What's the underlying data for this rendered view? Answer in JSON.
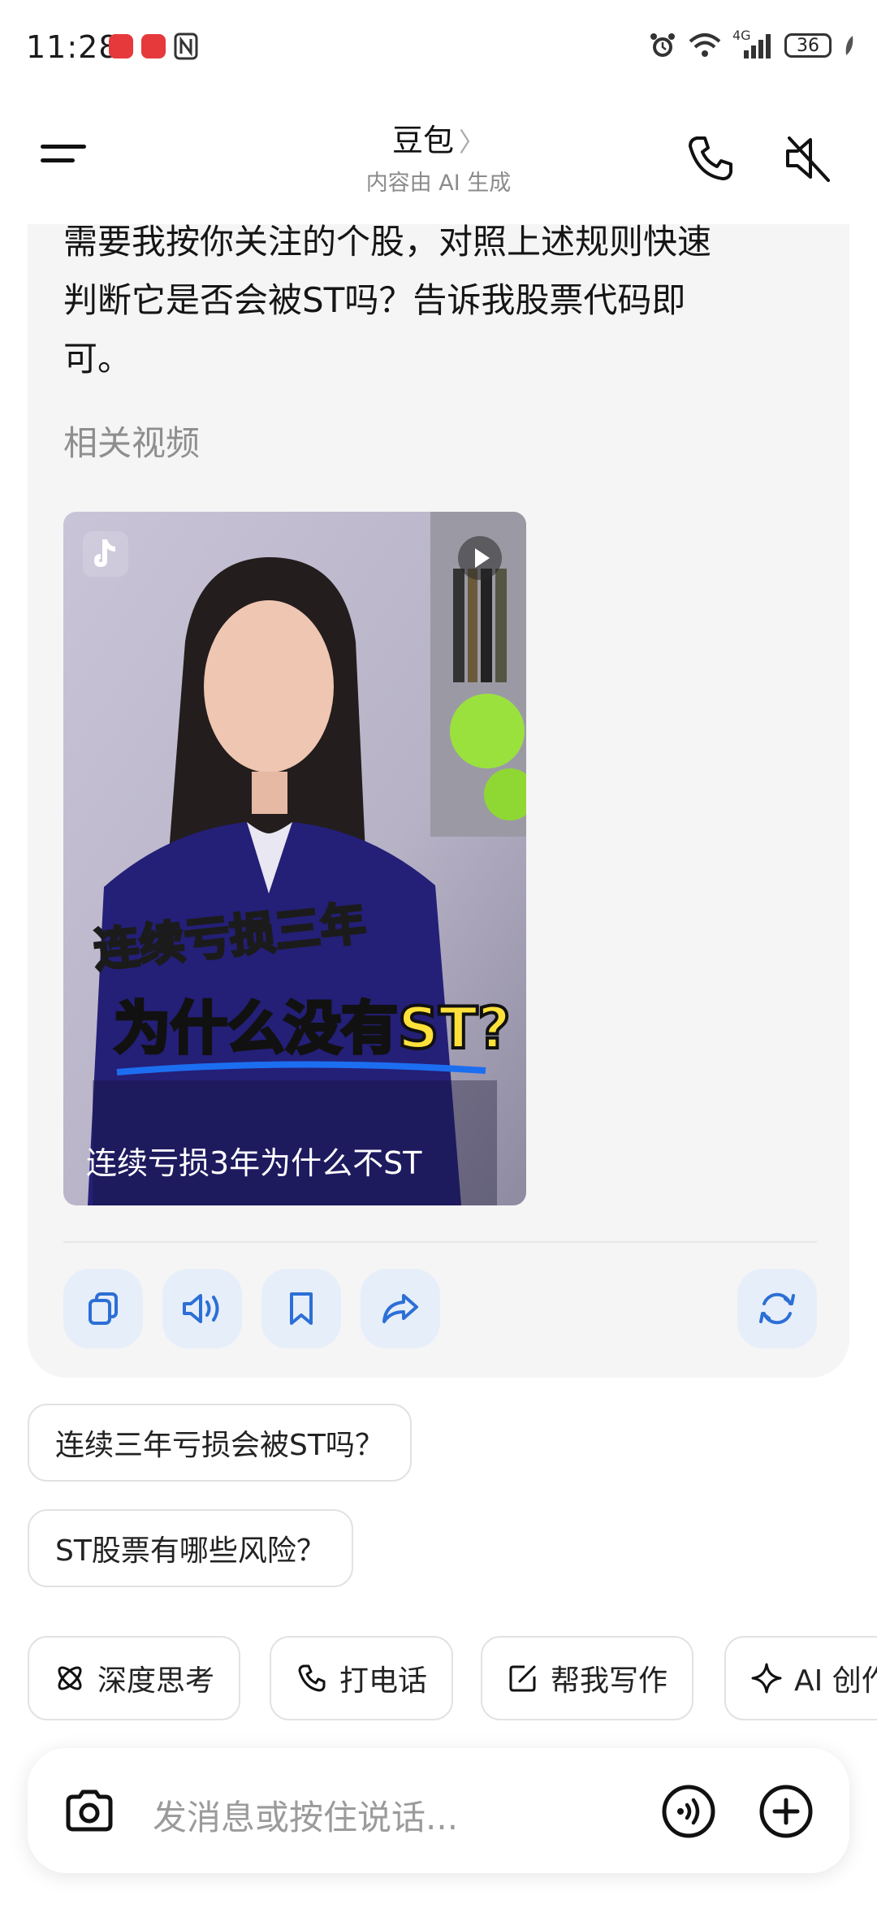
{
  "status": {
    "time": "11:28",
    "network": "4G",
    "battery": "36"
  },
  "header": {
    "title": "豆包",
    "title_chevron": "〉",
    "subtitle": "内容由 AI 生成"
  },
  "message": {
    "lines": [
      "需要我按你关注的个股，对照上述规则快速",
      "判断它是否会被ST吗？告诉我股票代码即",
      "可。"
    ],
    "related_label": "相关视频",
    "video": {
      "caption_top": "连续亏损三年",
      "caption_main": "为什么没有ST?",
      "title": "连续亏损3年为什么不ST"
    },
    "actions": [
      "copy-icon",
      "speaker-icon",
      "bookmark-icon",
      "share-icon",
      "regenerate-icon"
    ]
  },
  "suggestions": [
    "连续三年亏损会被ST吗？",
    "ST股票有哪些风险？"
  ],
  "chips": [
    "深度思考",
    "打电话",
    "帮我写作",
    "AI 创作"
  ],
  "input": {
    "placeholder": "发消息或按住说话..."
  },
  "colors": {
    "accent": "#2c6fd6",
    "action_bg": "#e6eef9",
    "card_bg": "#f5f5f6"
  }
}
